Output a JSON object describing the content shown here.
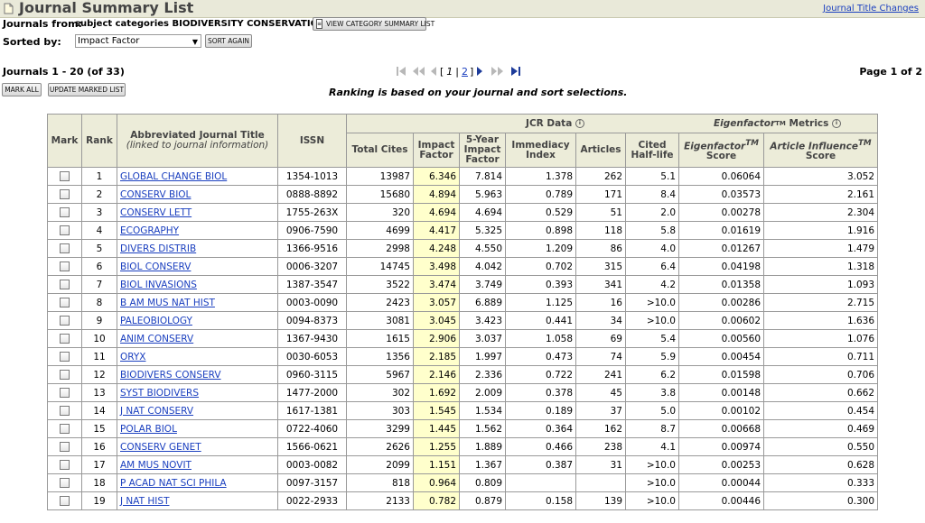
{
  "header": {
    "title": "Journal Summary List",
    "title_changes_link": "Journal Title Changes"
  },
  "filters": {
    "journals_from_label": "Journals from:",
    "journals_from_value": "subject categories BIODIVERSITY CONSERVATION",
    "category_button": "VIEW CATEGORY SUMMARY LIST",
    "sorted_by_label": "Sorted by:",
    "sort_value": "Impact Factor",
    "sort_again_button": "SORT AGAIN"
  },
  "listing": {
    "range": "Journals 1 - 20 (of 33)",
    "mark_all_button": "MARK ALL",
    "update_button": "UPDATE MARKED LIST",
    "ranking_note": "Ranking is based on your journal and sort selections.",
    "page_of": "Page 1 of 2",
    "pager": {
      "open": "[",
      "page1": "1",
      "sep": "|",
      "page2": "2",
      "close": "]"
    }
  },
  "table": {
    "headers": {
      "mark": "Mark",
      "rank": "Rank",
      "title": "Abbreviated Journal Title",
      "title_sub": "(linked to journal information)",
      "issn": "ISSN",
      "jcr_group": "JCR Data",
      "eigen_group": "Eigenfactor",
      "eigen_group_sup": "TM",
      "eigen_group_suffix": "Metrics",
      "total_cites": "Total Cites",
      "impact_factor": "Impact Factor",
      "five_year": "5-Year Impact Factor",
      "immediacy": "Immediacy Index",
      "articles": "Articles",
      "half_life": "Cited Half-life",
      "eigen_score": "Eigenfactor",
      "eigen_score_sup": "TM",
      "eigen_score_sub": "Score",
      "ai_score": "Article Influence",
      "ai_score_sup": "TM",
      "ai_score_sub": "Score"
    },
    "rows": [
      {
        "rank": "1",
        "title": "GLOBAL CHANGE BIOL",
        "issn": "1354-1013",
        "total_cites": "13987",
        "impact_factor": "6.346",
        "five_year": "7.814",
        "immediacy": "1.378",
        "articles": "262",
        "half_life": "5.1",
        "eigen": "0.06064",
        "ai": "3.052"
      },
      {
        "rank": "2",
        "title": "CONSERV BIOL",
        "issn": "0888-8892",
        "total_cites": "15680",
        "impact_factor": "4.894",
        "five_year": "5.963",
        "immediacy": "0.789",
        "articles": "171",
        "half_life": "8.4",
        "eigen": "0.03573",
        "ai": "2.161"
      },
      {
        "rank": "3",
        "title": "CONSERV LETT",
        "issn": "1755-263X",
        "total_cites": "320",
        "impact_factor": "4.694",
        "five_year": "4.694",
        "immediacy": "0.529",
        "articles": "51",
        "half_life": "2.0",
        "eigen": "0.00278",
        "ai": "2.304"
      },
      {
        "rank": "4",
        "title": "ECOGRAPHY",
        "issn": "0906-7590",
        "total_cites": "4699",
        "impact_factor": "4.417",
        "five_year": "5.325",
        "immediacy": "0.898",
        "articles": "118",
        "half_life": "5.8",
        "eigen": "0.01619",
        "ai": "1.916"
      },
      {
        "rank": "5",
        "title": "DIVERS DISTRIB",
        "issn": "1366-9516",
        "total_cites": "2998",
        "impact_factor": "4.248",
        "five_year": "4.550",
        "immediacy": "1.209",
        "articles": "86",
        "half_life": "4.0",
        "eigen": "0.01267",
        "ai": "1.479"
      },
      {
        "rank": "6",
        "title": "BIOL CONSERV",
        "issn": "0006-3207",
        "total_cites": "14745",
        "impact_factor": "3.498",
        "five_year": "4.042",
        "immediacy": "0.702",
        "articles": "315",
        "half_life": "6.4",
        "eigen": "0.04198",
        "ai": "1.318"
      },
      {
        "rank": "7",
        "title": "BIOL INVASIONS",
        "issn": "1387-3547",
        "total_cites": "3522",
        "impact_factor": "3.474",
        "five_year": "3.749",
        "immediacy": "0.393",
        "articles": "341",
        "half_life": "4.2",
        "eigen": "0.01358",
        "ai": "1.093"
      },
      {
        "rank": "8",
        "title": "B AM MUS NAT HIST",
        "issn": "0003-0090",
        "total_cites": "2423",
        "impact_factor": "3.057",
        "five_year": "6.889",
        "immediacy": "1.125",
        "articles": "16",
        "half_life": ">10.0",
        "eigen": "0.00286",
        "ai": "2.715"
      },
      {
        "rank": "9",
        "title": "PALEOBIOLOGY",
        "issn": "0094-8373",
        "total_cites": "3081",
        "impact_factor": "3.045",
        "five_year": "3.423",
        "immediacy": "0.441",
        "articles": "34",
        "half_life": ">10.0",
        "eigen": "0.00602",
        "ai": "1.636"
      },
      {
        "rank": "10",
        "title": "ANIM CONSERV",
        "issn": "1367-9430",
        "total_cites": "1615",
        "impact_factor": "2.906",
        "five_year": "3.037",
        "immediacy": "1.058",
        "articles": "69",
        "half_life": "5.4",
        "eigen": "0.00560",
        "ai": "1.076"
      },
      {
        "rank": "11",
        "title": "ORYX",
        "issn": "0030-6053",
        "total_cites": "1356",
        "impact_factor": "2.185",
        "five_year": "1.997",
        "immediacy": "0.473",
        "articles": "74",
        "half_life": "5.9",
        "eigen": "0.00454",
        "ai": "0.711"
      },
      {
        "rank": "12",
        "title": "BIODIVERS CONSERV",
        "issn": "0960-3115",
        "total_cites": "5967",
        "impact_factor": "2.146",
        "five_year": "2.336",
        "immediacy": "0.722",
        "articles": "241",
        "half_life": "6.2",
        "eigen": "0.01598",
        "ai": "0.706"
      },
      {
        "rank": "13",
        "title": "SYST BIODIVERS",
        "issn": "1477-2000",
        "total_cites": "302",
        "impact_factor": "1.692",
        "five_year": "2.009",
        "immediacy": "0.378",
        "articles": "45",
        "half_life": "3.8",
        "eigen": "0.00148",
        "ai": "0.662"
      },
      {
        "rank": "14",
        "title": "J NAT CONSERV",
        "issn": "1617-1381",
        "total_cites": "303",
        "impact_factor": "1.545",
        "five_year": "1.534",
        "immediacy": "0.189",
        "articles": "37",
        "half_life": "5.0",
        "eigen": "0.00102",
        "ai": "0.454"
      },
      {
        "rank": "15",
        "title": "POLAR BIOL",
        "issn": "0722-4060",
        "total_cites": "3299",
        "impact_factor": "1.445",
        "five_year": "1.562",
        "immediacy": "0.364",
        "articles": "162",
        "half_life": "8.7",
        "eigen": "0.00668",
        "ai": "0.469"
      },
      {
        "rank": "16",
        "title": "CONSERV GENET",
        "issn": "1566-0621",
        "total_cites": "2626",
        "impact_factor": "1.255",
        "five_year": "1.889",
        "immediacy": "0.466",
        "articles": "238",
        "half_life": "4.1",
        "eigen": "0.00974",
        "ai": "0.550"
      },
      {
        "rank": "17",
        "title": "AM MUS NOVIT",
        "issn": "0003-0082",
        "total_cites": "2099",
        "impact_factor": "1.151",
        "five_year": "1.367",
        "immediacy": "0.387",
        "articles": "31",
        "half_life": ">10.0",
        "eigen": "0.00253",
        "ai": "0.628"
      },
      {
        "rank": "18",
        "title": "P ACAD NAT SCI PHILA",
        "issn": "0097-3157",
        "total_cites": "818",
        "impact_factor": "0.964",
        "five_year": "0.809",
        "immediacy": "",
        "articles": "",
        "half_life": ">10.0",
        "eigen": "0.00044",
        "ai": "0.333"
      },
      {
        "rank": "19",
        "title": "J NAT HIST",
        "issn": "0022-2933",
        "total_cites": "2133",
        "impact_factor": "0.782",
        "five_year": "0.879",
        "immediacy": "0.158",
        "articles": "139",
        "half_life": ">10.0",
        "eigen": "0.00446",
        "ai": "0.300"
      }
    ]
  }
}
